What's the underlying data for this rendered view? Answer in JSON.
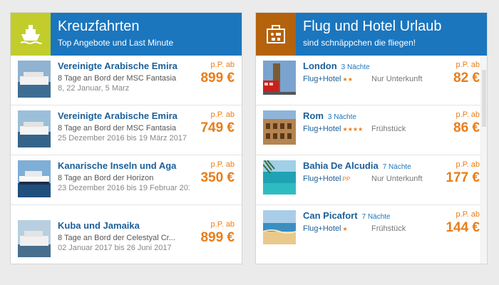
{
  "cruises": {
    "title": "Kreuzfahrten",
    "subtitle": "Top Angebote und Last Minute",
    "icon": "ship-icon",
    "items": [
      {
        "title": "Vereinigte Arabische Emira",
        "line2": "8 Tage an Bord der MSC Fantasia",
        "line3": "8, 22 Januar, 5 Marz",
        "pp": "p.P. ab",
        "price": "899 €"
      },
      {
        "title": "Vereinigte Arabische Emira",
        "line2": "8 Tage an Bord der MSC Fantasia",
        "line3": "25 Dezember 2016 bis 19 März 2017",
        "pp": "p.P. ab",
        "price": "749 €"
      },
      {
        "title": "Kanarische Inseln und Aga",
        "line2": "8 Tage an Bord der Horizon",
        "line3": "23 Dezember 2016 bis 19 Februar 2017",
        "pp": "p.P. ab",
        "price": "350 €"
      },
      {
        "title": "Kuba und Jamaika",
        "line2": "8 Tage an Bord der Celestyal Cr...",
        "line3": "02 Januar 2017 bis 26 Juni 2017",
        "pp": "p.P. ab",
        "price": "899 €"
      }
    ]
  },
  "trips": {
    "title": "Flug und Hotel Urlaub",
    "subtitle": "sind schnäppchen die fliegen!",
    "icon": "suitcase-icon",
    "items": [
      {
        "city": "London",
        "nights": "3 Nächte",
        "fh": "Flug+Hotel",
        "stars": "★★",
        "board": "Nur Unterkunft",
        "pp": "p.P. ab",
        "price": "82 €"
      },
      {
        "city": "Rom",
        "nights": "3 Nächte",
        "fh": "Flug+Hotel",
        "stars": "★★★★",
        "board": "Frühstück",
        "pp": "p.P. ab",
        "price": "86 €"
      },
      {
        "city": "Bahia De Alcudia",
        "nights": "7 Nächte",
        "fh": "Flug+Hotel",
        "stars": "PP",
        "board": "Nur Unterkunft",
        "pp": "p.P. ab",
        "price": "177 €"
      },
      {
        "city": "Can Picafort",
        "nights": "7 Nächte",
        "fh": "Flug+Hotel",
        "stars": "★",
        "board": "Frühstück",
        "pp": "p.P. ab",
        "price": "144 €"
      }
    ]
  },
  "colors": {
    "accent": "#1b76be",
    "price": "#e97d18",
    "cruise_icon_bg": "#c2cd2b",
    "trip_icon_bg": "#b4620c"
  }
}
